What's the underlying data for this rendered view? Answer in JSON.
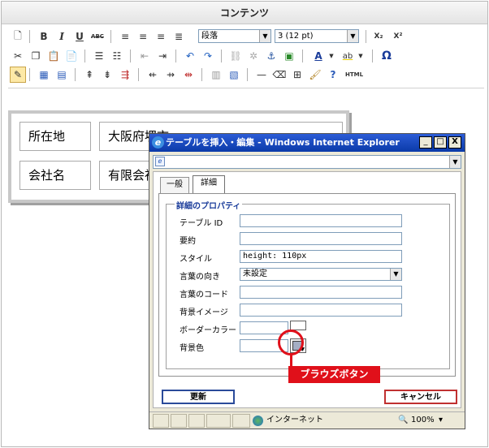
{
  "editor": {
    "title": "コンテンツ",
    "toolbar": {
      "paragraph_select": "段落",
      "fontsize_select": "3 (12 pt)",
      "bold": "B",
      "italic": "I",
      "underline": "U",
      "strike": "ABC",
      "subscript": "X₂",
      "superscript": "X²",
      "font_color": "A",
      "highlight": "ab",
      "omega": "Ω",
      "html": "HTML"
    },
    "doc_table": {
      "cells": [
        [
          "所在地",
          "大阪府堺市"
        ],
        [
          "会社名",
          "有限会社"
        ]
      ]
    }
  },
  "ie_window": {
    "title": "テーブルを挿入・編集 - Windows Internet Explorer",
    "controls": {
      "minimize": "_",
      "maximize": "□",
      "close": "X"
    },
    "tabs": [
      {
        "label": "一般",
        "selected": false
      },
      {
        "label": "詳細",
        "selected": true
      }
    ],
    "legend": "詳細のプロパティ",
    "fields": {
      "table_id": {
        "label": "テーブル ID",
        "value": ""
      },
      "summary": {
        "label": "要約",
        "value": ""
      },
      "style": {
        "label": "スタイル",
        "value": "height: 110px"
      },
      "direction": {
        "label": "言葉の向き",
        "value": "未設定"
      },
      "lang_code": {
        "label": "言葉のコード",
        "value": ""
      },
      "bg_image": {
        "label": "背景イメージ",
        "value": ""
      },
      "border_color": {
        "label": "ボーダーカラー",
        "value": ""
      },
      "bg_color": {
        "label": "背景色",
        "value": ""
      }
    },
    "buttons": {
      "update": "更新",
      "cancel": "キャンセル"
    },
    "annotation": "ブラウズボタン",
    "status": {
      "zone": "インターネット",
      "zoom": "100%",
      "zoom_caret": "▾"
    }
  },
  "colors": {
    "accent_red": "#e0101a",
    "ie_title_blue": "#0a3aa8",
    "swatch_fill": "#a4aec4"
  }
}
